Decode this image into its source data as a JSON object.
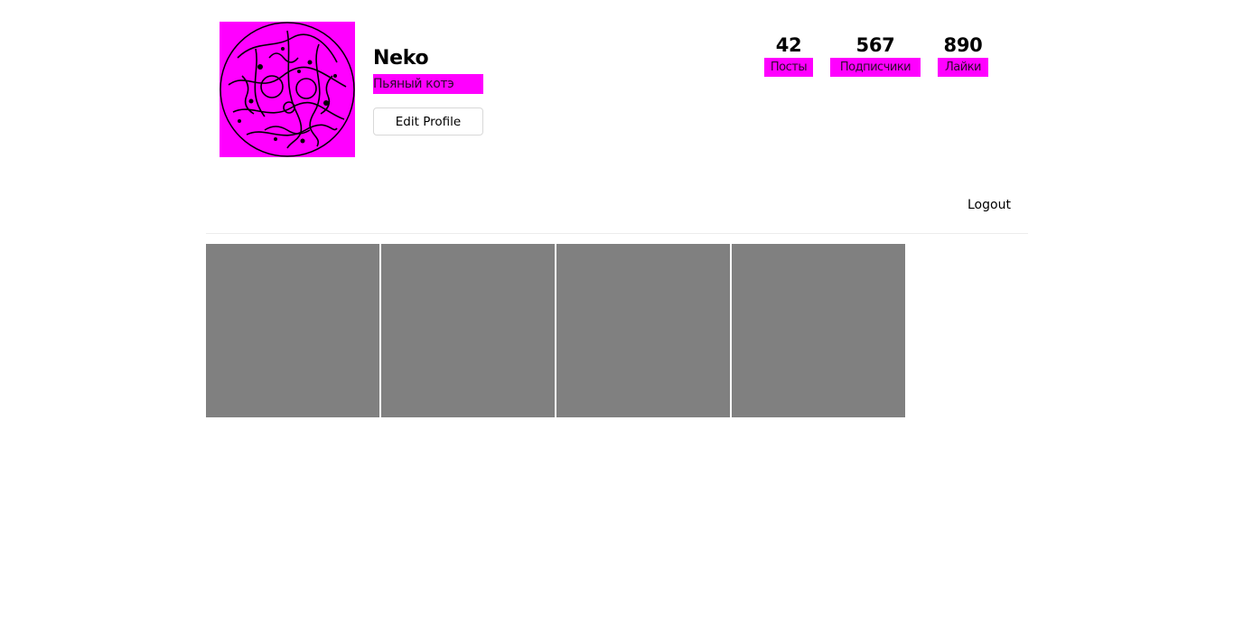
{
  "profile": {
    "name": "Neko",
    "bio": "Пьяный котэ"
  },
  "stats": [
    {
      "value": "42",
      "label": "Посты"
    },
    {
      "value": "567",
      "label": "Подписчики"
    },
    {
      "value": "890",
      "label": "Лайки"
    }
  ],
  "actions": {
    "edit_profile": "Edit Profile",
    "logout": "Logout"
  },
  "posts": [
    {
      "color": "#808080"
    },
    {
      "color": "#808080"
    },
    {
      "color": "#808080"
    },
    {
      "color": "#808080"
    }
  ],
  "colors": {
    "highlight": "#ff00ff",
    "tile": "#808080",
    "border": "#d8d8d8"
  },
  "icons": {
    "avatar": "cat-avatar-image"
  }
}
